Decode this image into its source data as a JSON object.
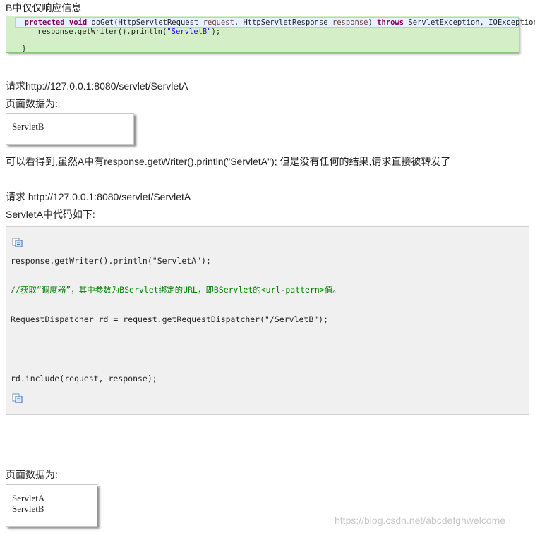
{
  "heading_b": "B中仅仅响应信息",
  "eclipse_code": {
    "line1_kw1": "protected",
    "line1_kw2": "void",
    "line1_sig": " doGet(HttpServletRequest ",
    "line1_p1": "request",
    "line1_mid": ", HttpServletResponse ",
    "line1_p2": "response",
    "line1_end": ") ",
    "line1_throws": "throws",
    "line1_exc": " ServletException, IOException {",
    "line2_pre": "response.getWriter().println(",
    "line2_str": "\"ServletB\"",
    "line2_post": ");",
    "line3": "}"
  },
  "request_1": "请求http://127.0.0.1:8080/servlet/ServletA",
  "page_data_label_1": "页面数据为:",
  "result_1": [
    "ServletB"
  ],
  "observation": "可以看得到,虽然A中有response.getWriter().println(\"ServletA\");  但是没有任何的结果,请求直接被转发了",
  "request_2": "请求 http://127.0.0.1:8080/servlet/ServletA",
  "servleta_code_intro": "ServletA中代码如下:",
  "code_lines": {
    "l1": "response.getWriter().println(\"ServletA\");",
    "l2": "//获取“调度器”，其中参数为BServlet绑定的URL，即BServlet的<url-pattern>值。",
    "l3": "RequestDispatcher rd = request.getRequestDispatcher(\"/ServletB\");",
    "l4": "rd.include(request, response);"
  },
  "page_data_label_2": "页面数据为:",
  "result_2": [
    "ServletA",
    "ServletB"
  ],
  "watermark": "https://blog.csdn.net/abcdefghwelcome",
  "icons": {
    "copy": "copy-icon"
  }
}
